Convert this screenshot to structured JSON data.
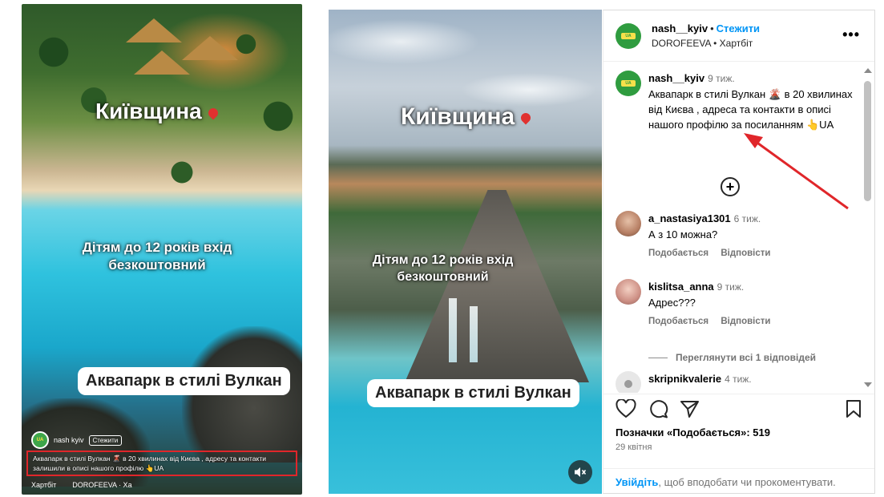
{
  "left_video": {
    "title": "Київщина",
    "free_kids_text": "Дітям до 12 років вхід безкоштовний",
    "banner": "Аквапарк в стилі Вулкан",
    "account": "nash kyiv",
    "follow_label": "Стежити",
    "caption": "Аквапарк в стилі Вулкан 🌋 в 20 хвилинах від Києва , адресу та контакти залишили в описі нашого профілю 👆UA",
    "music": "Хартбіт",
    "music_artist": "DOROFEEVA · Ха"
  },
  "post_media": {
    "title": "Київщина",
    "free_kids_text": "Дітям до 12 років вхід безкоштовний",
    "banner": "Аквапарк в стилі Вулкан"
  },
  "header": {
    "username": "nash__kyiv",
    "separator": "•",
    "follow": "Стежити",
    "audio": "DOROFEEVA • Хартбіт",
    "more": "•••"
  },
  "caption": {
    "username": "nash__kyiv",
    "time": "9 тиж.",
    "text": "Аквапарк в стилі Вулкан 🌋 в 20 хвилинах від Києва , адреса та контакти в описі нашого профілю за посиланням 👆UA"
  },
  "comments": [
    {
      "username": "a_nastasiya1301",
      "time": "6 тиж.",
      "text": "А з 10 можна?",
      "like": "Подобається",
      "reply": "Відповісти"
    },
    {
      "username": "kislitsa_anna",
      "time": "9 тиж.",
      "text": "Адрес???",
      "like": "Подобається",
      "reply": "Відповісти"
    },
    {
      "username": "skripnikvalerie",
      "time": "4 тиж.",
      "text": ""
    }
  ],
  "view_replies": "Переглянути всі 1 відповідей",
  "likes": "Позначки «Подобається»: 519",
  "date": "29 квітня",
  "login": {
    "link": "Увійдіть",
    "rest": ", щоб вподобати чи прокоментувати."
  },
  "colors": {
    "accent_blue": "#0095f6",
    "highlight_red": "#e0262a",
    "avatar_green": "#2f9c3f"
  }
}
